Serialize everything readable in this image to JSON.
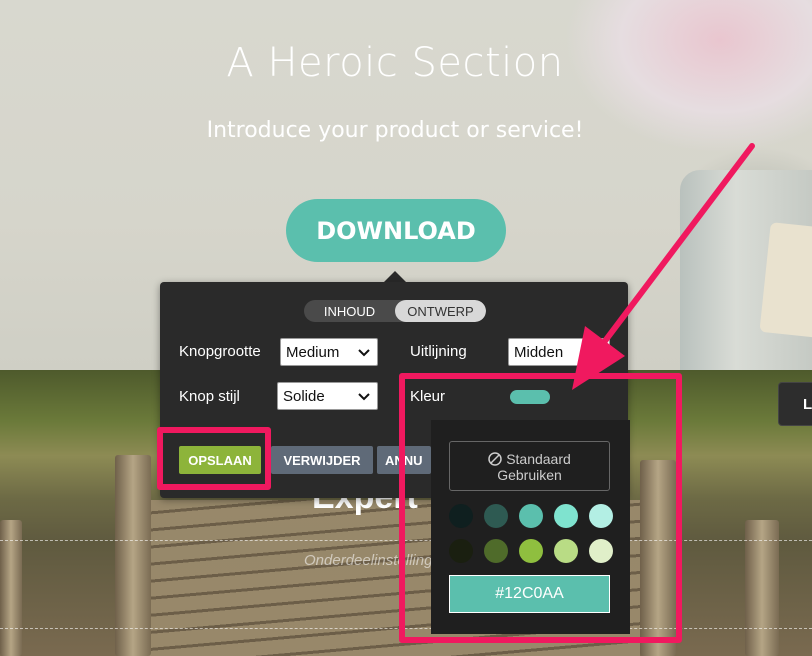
{
  "hero": {
    "title": "A Heroic Section",
    "subtitle": "Introduce your product or service!",
    "download_label": "DOWNLOAD"
  },
  "section2": {
    "heading_partial": "Expert",
    "faint_text": "Onderdeelinstellingen",
    "side_button_label": "L"
  },
  "panel": {
    "tabs": [
      {
        "label": "INHOUD",
        "active": false
      },
      {
        "label": "ONTWERP",
        "active": true
      }
    ],
    "knopgrootte_label": "Knopgrootte",
    "knopgrootte_value": "Medium",
    "uitlijning_label": "Uitlijning",
    "uitlijning_value": "Midden",
    "knopstijl_label": "Knop stijl",
    "knopstijl_value": "Solide",
    "kleur_label": "Kleur",
    "opslaan_label": "OPSLAAN",
    "verwijder_label": "VERWIJDER",
    "annuleren_partial": "ANNU"
  },
  "picker": {
    "standard_label_line1": "Standaard",
    "standard_label_line2": "Gebruiken",
    "swatches_row1": [
      "#0f1f1f",
      "#2e5a52",
      "#5bbfad",
      "#7fe3cf",
      "#b3efe4"
    ],
    "swatches_row2": [
      "#1a1f10",
      "#4f6b2a",
      "#8fbf3f",
      "#b9dc85",
      "#e0efc9"
    ],
    "hex_value": "#12C0AA"
  },
  "colors": {
    "accent_teal": "#5bbfad",
    "highlight": "#f0195f",
    "save_green": "#8db43a",
    "panel_bg": "#2a2a2a"
  }
}
